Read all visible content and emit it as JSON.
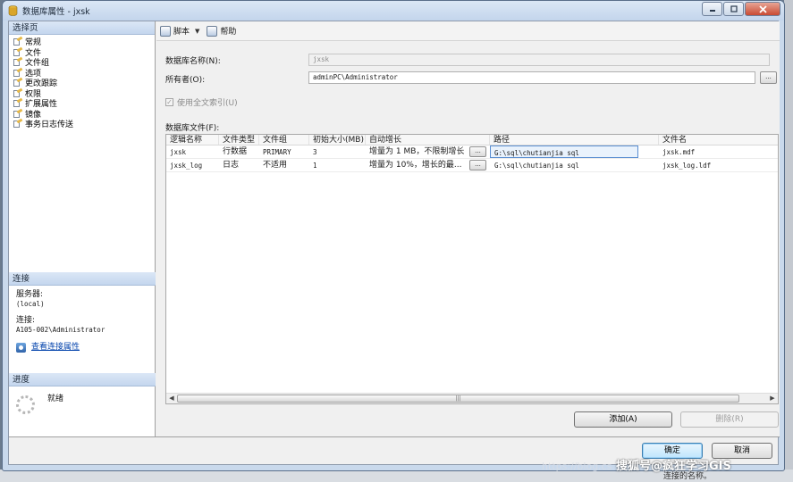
{
  "window": {
    "title": "数据库属性 - jxsk"
  },
  "left": {
    "select_page_header": "选择页",
    "pages": [
      {
        "label": "常规"
      },
      {
        "label": "文件"
      },
      {
        "label": "文件组"
      },
      {
        "label": "选项"
      },
      {
        "label": "更改跟踪"
      },
      {
        "label": "权限"
      },
      {
        "label": "扩展属性"
      },
      {
        "label": "镜像"
      },
      {
        "label": "事务日志传送"
      }
    ],
    "connection_header": "连接",
    "server_label": "服务器:",
    "server_value": "(local)",
    "connection_label": "连接:",
    "connection_value": "A105-002\\Administrator",
    "view_link": "查看连接属性",
    "progress_header": "进度",
    "progress_status": "就绪"
  },
  "toolbar": {
    "script_label": "脚本",
    "help_label": "帮助"
  },
  "form": {
    "db_name_label": "数据库名称(N):",
    "db_name_value": "jxsk",
    "owner_label": "所有者(O):",
    "owner_value": "adminPC\\Administrator",
    "fulltext_label": "使用全文索引(U)",
    "fulltext_checked": true,
    "files_label": "数据库文件(F):",
    "ellipsis": "..."
  },
  "grid": {
    "columns": [
      "逻辑名称",
      "文件类型",
      "文件组",
      "初始大小(MB)",
      "自动增长",
      "路径",
      "文件名"
    ],
    "rows": [
      {
        "logical": "jxsk",
        "type": "行数据",
        "group": "PRIMARY",
        "size": "3",
        "growth": "增量为 1 MB，不限制增长",
        "path": "G:\\sql\\chutianjia sql",
        "file": "jxsk.mdf"
      },
      {
        "logical": "jxsk_log",
        "type": "日志",
        "group": "不适用",
        "size": "1",
        "growth": "增量为 10%，增长的最...",
        "path": "G:\\sql\\chutianjia sql",
        "file": "jxsk_log.ldf"
      }
    ],
    "scroll_grip": "|||"
  },
  "buttons": {
    "add": "添加(A)",
    "remove": "删除(R)",
    "ok": "确定",
    "cancel": "取消"
  },
  "overlay": {
    "watermark": "搜狐号@疯狂学习GIS",
    "url_fragment": "https://blog.cs",
    "bottom_hint": "连接的名称。"
  },
  "colors": {
    "accent": "#3c7fb1",
    "link": "#0645ad",
    "header_gradient_top": "#dbe7f6"
  }
}
